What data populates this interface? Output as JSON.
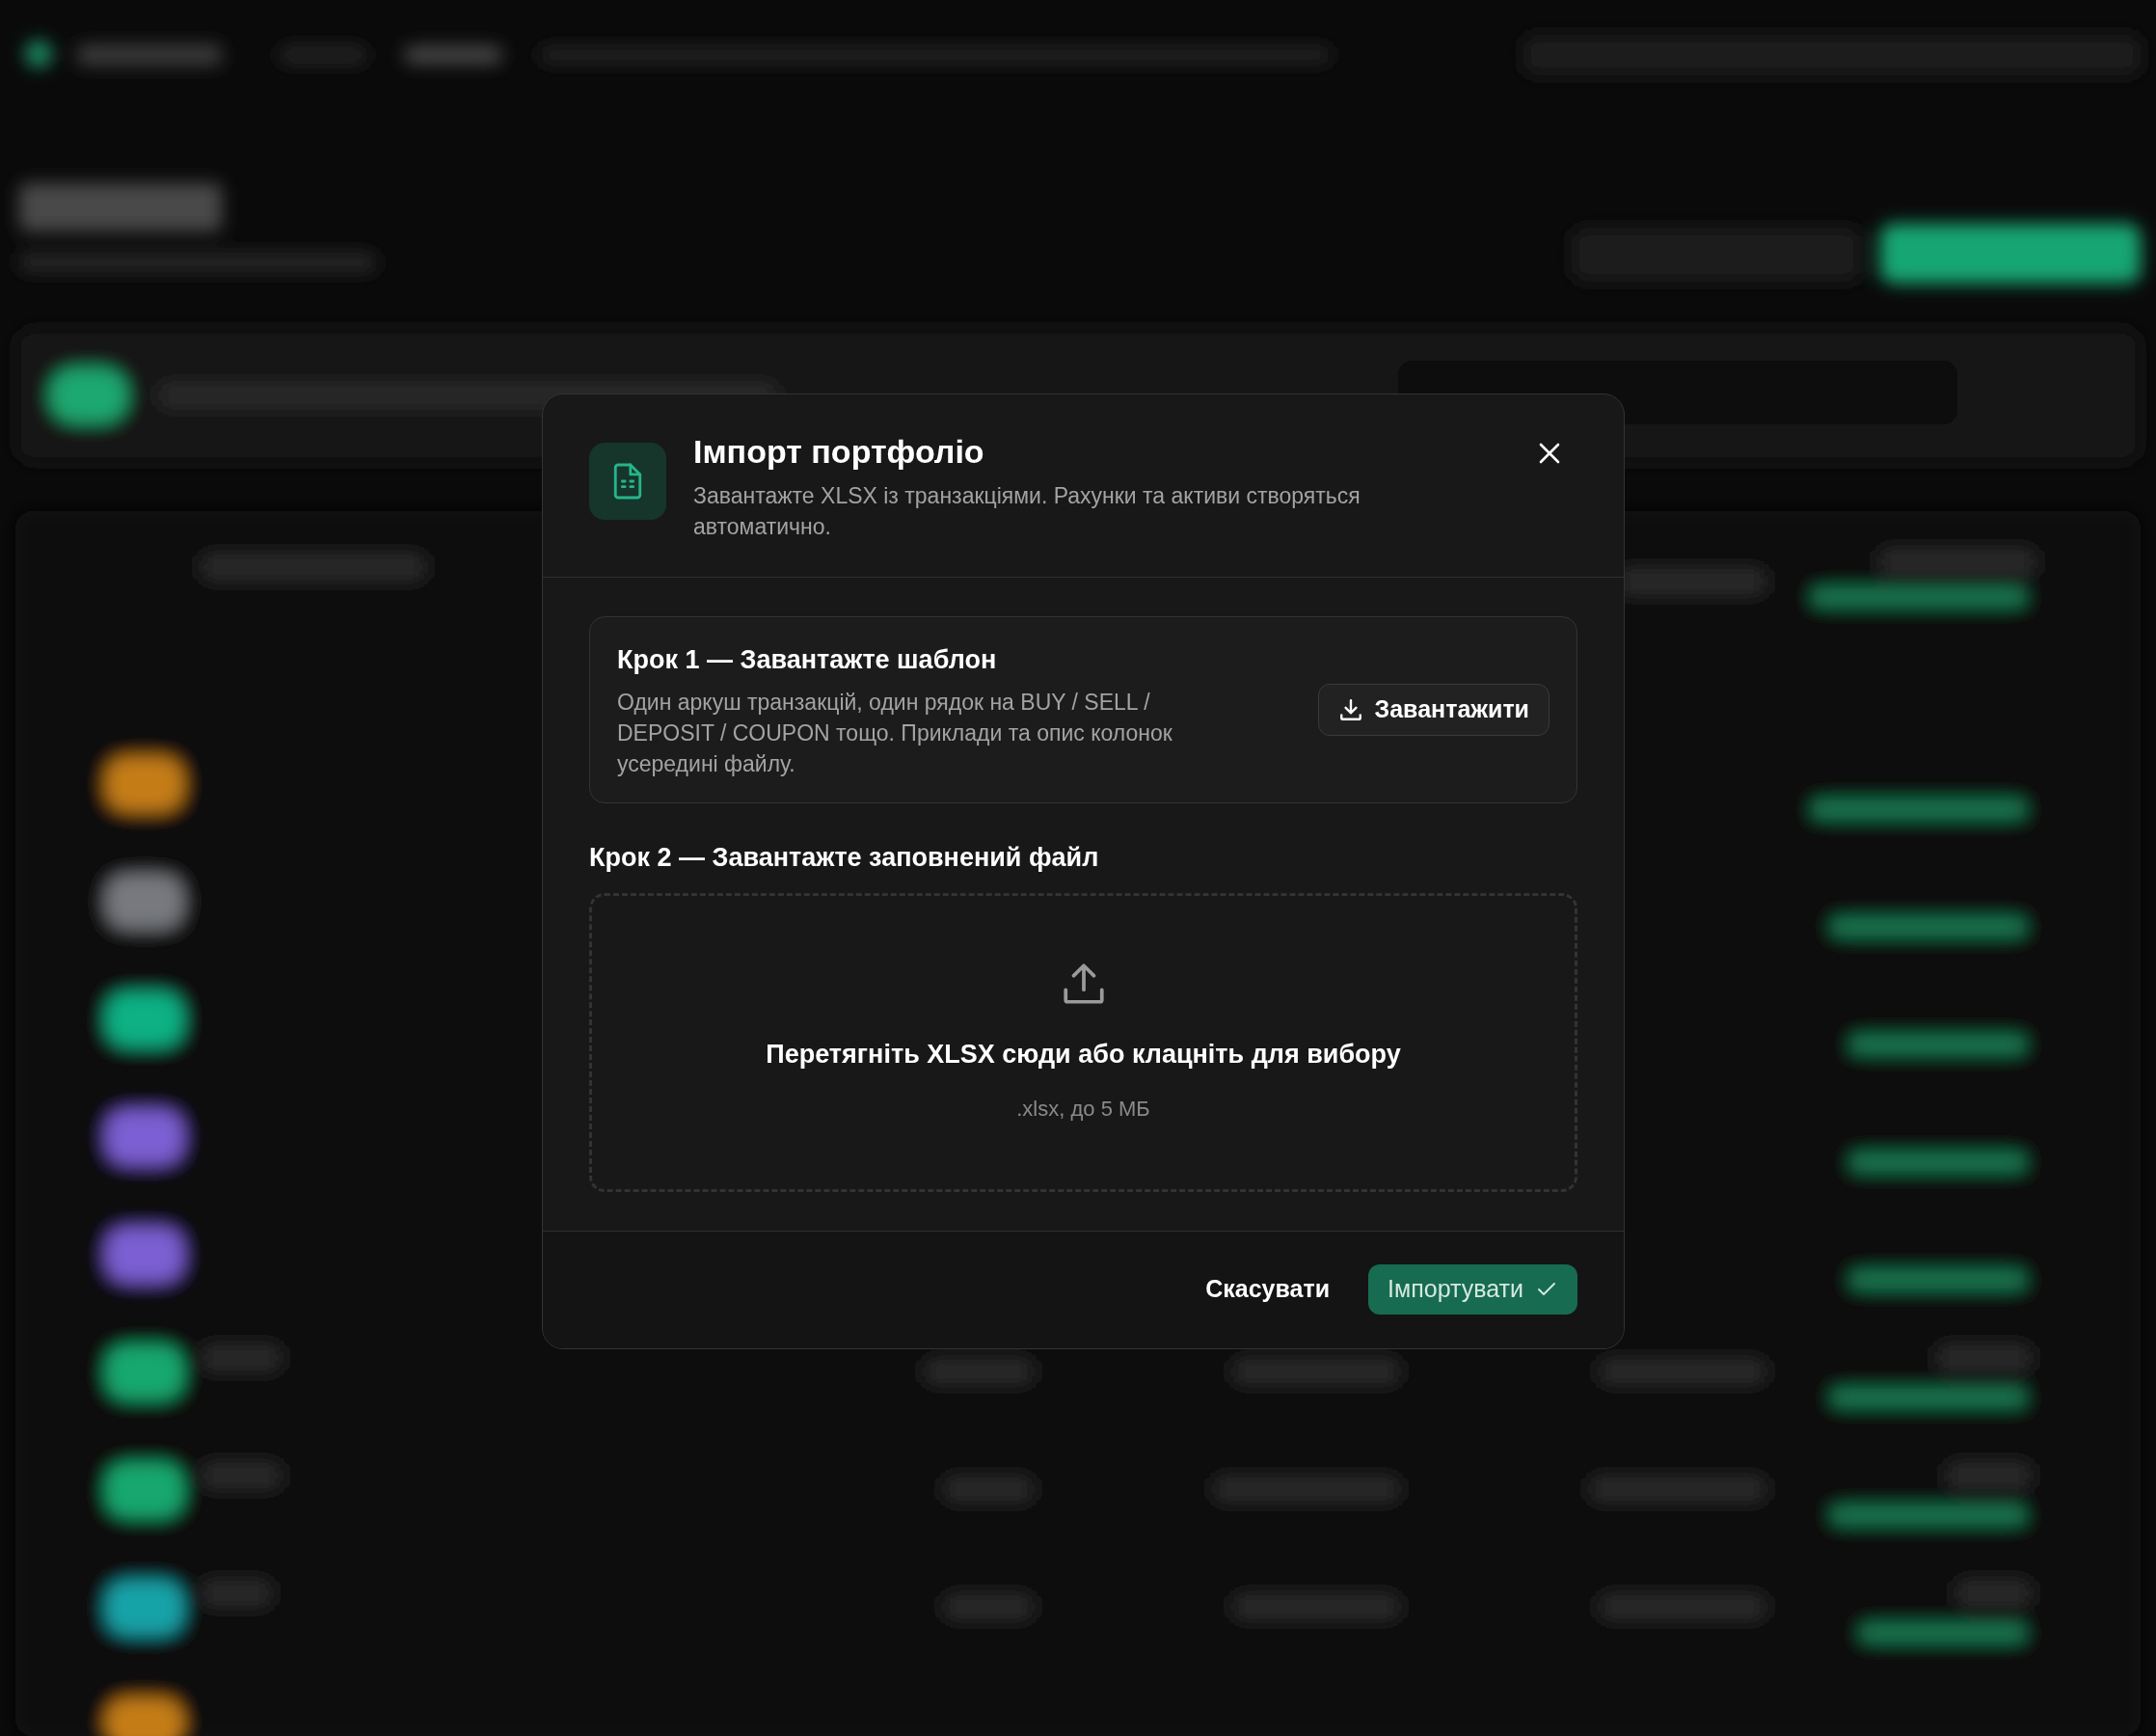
{
  "dialog": {
    "title": "Імпорт портфоліо",
    "subtitle": "Завантажте XLSX із транзакціями. Рахунки та активи створяться автоматично.",
    "step1": {
      "title": "Крок 1 — Завантажте шаблон",
      "description": "Один аркуш транзакцій, один рядок на BUY / SELL / DEPOSIT / COUPON тощо. Приклади та опис колонок усередині файлу.",
      "button": "Завантажити"
    },
    "step2": {
      "title": "Крок 2 — Завантажте заповнений файл",
      "drop_text": "Перетягніть XLSX сюди або клацніть для вибору",
      "hint": ".xlsx, до 5 МБ"
    },
    "buttons": [
      {
        "label": "Скасувати",
        "kind": "secondary"
      },
      {
        "label": "Імпортувати",
        "kind": "primary"
      }
    ]
  }
}
